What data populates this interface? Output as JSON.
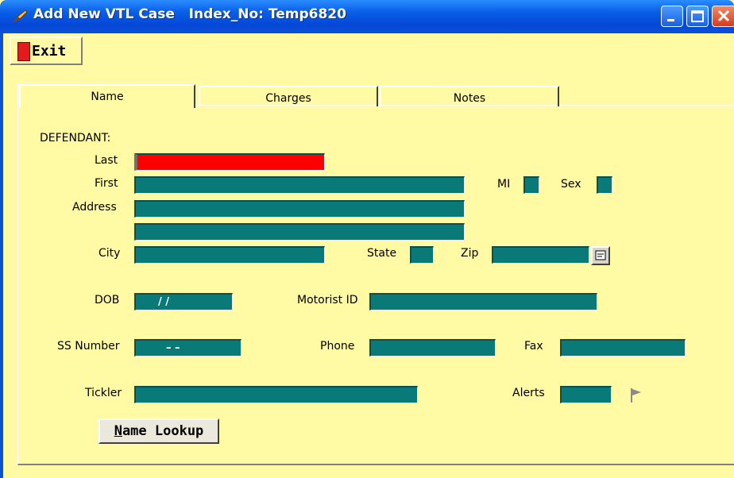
{
  "window": {
    "title": "Add New VTL Case",
    "index_label": "Index_No: Temp6820"
  },
  "toolbar": {
    "exit_label": "Exit"
  },
  "tabs": [
    {
      "label": "Name",
      "active": true
    },
    {
      "label": "Charges",
      "active": false
    },
    {
      "label": "Notes",
      "active": false
    }
  ],
  "form": {
    "section_label": "DEFENDANT:",
    "last_label": "Last",
    "first_label": "First",
    "mi_label": "MI",
    "sex_label": "Sex",
    "address_label": "Address",
    "city_label": "City",
    "state_label": "State",
    "zip_label": "Zip",
    "dob_label": "DOB",
    "dob_mask": "/    /",
    "motorist_label": "Motorist ID",
    "ss_label": "SS Number",
    "ss_mask": "–   –",
    "phone_label": "Phone",
    "fax_label": "Fax",
    "tickler_label": "Tickler",
    "alerts_label": "Alerts",
    "lookup_first": "N",
    "lookup_rest": "ame Lookup"
  },
  "colors": {
    "field": "#0a7a78",
    "required": "#ff0000",
    "background": "#fffaa3"
  },
  "icons": [
    "app-icon",
    "exit-door-icon",
    "zip-lookup-icon",
    "alert-flag-icon"
  ]
}
